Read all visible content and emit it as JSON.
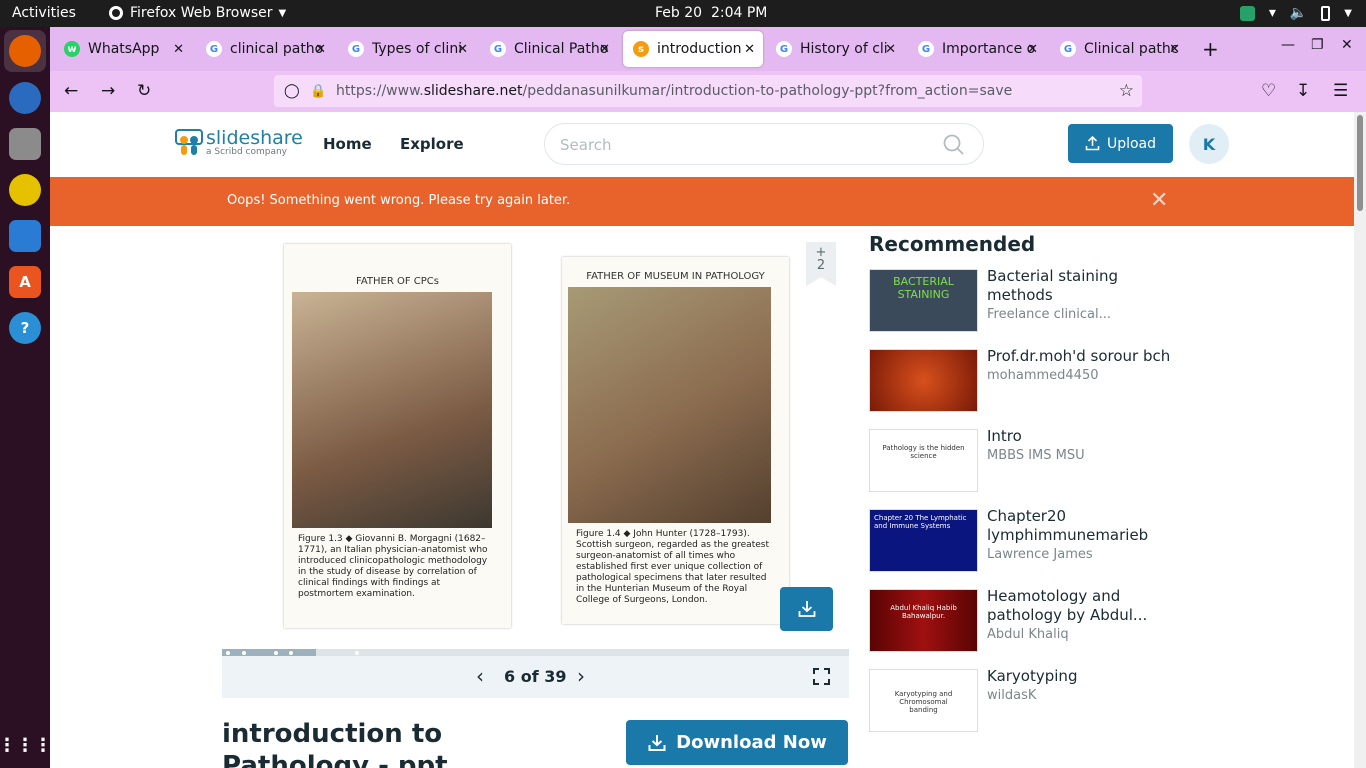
{
  "os": {
    "activities": "Activities",
    "app_name": "Firefox Web Browser",
    "date": "Feb 20",
    "time": "2:04 PM"
  },
  "tabs": [
    {
      "label": "WhatsApp",
      "icon": "whatsapp-icon",
      "color": "#25d366"
    },
    {
      "label": "clinical patho",
      "icon": "google-icon",
      "color": "#4285f4"
    },
    {
      "label": "Types of clini",
      "icon": "google-icon",
      "color": "#4285f4"
    },
    {
      "label": "Clinical Patho",
      "icon": "google-icon",
      "color": "#4285f4"
    },
    {
      "label": "introduction",
      "icon": "slideshare-icon",
      "color": "#f39c12"
    },
    {
      "label": "History of cli",
      "icon": "google-icon",
      "color": "#4285f4"
    },
    {
      "label": "Importance o",
      "icon": "google-icon",
      "color": "#4285f4"
    },
    {
      "label": "Clinical pathc",
      "icon": "google-icon",
      "color": "#4285f4"
    }
  ],
  "url": {
    "prefix": "https://www.",
    "domain": "slideshare.net",
    "path": "/peddanasunilkumar/introduction-to-pathology-ppt?from_action=save"
  },
  "site": {
    "logo": "slideshare",
    "logo_sub": "a Scribd company",
    "nav": [
      "Home",
      "Explore"
    ],
    "search_placeholder": "Search",
    "upload_label": "Upload",
    "avatar_letter": "K",
    "alert": "Oops! Something went wrong. Please try again later.",
    "badge_plus": "+",
    "badge_count": "2"
  },
  "slide": {
    "left_caption": "FATHER OF CPCs",
    "left_figure": "Figure 1.3 ◆ Giovanni B. Morgagni (1682–1771), an Italian physician-anatomist who introduced clinicopathologic methodology in the study of disease by correlation of clinical findings with findings at postmortem examination.",
    "right_caption": "FATHER OF MUSEUM IN PATHOLOGY",
    "right_figure": "Figure 1.4 ◆ John Hunter (1728–1793). Scottish surgeon, regarded as the greatest surgeon-anatomist of all times who established first ever unique collection of pathological specimens that later resulted in the Hunterian Museum of the Royal College of Surgeons, London.",
    "page_indicator": "6 of 39",
    "progress": 0.15
  },
  "document": {
    "title": "introduction to Pathology - ppt",
    "download_label": "Download Now"
  },
  "recommended": {
    "heading": "Recommended",
    "items": [
      {
        "title": "Bacterial staining methods",
        "author": "Freelance clinical...",
        "thumb_text": "BACTERIAL STAINING",
        "thumb_bg": "#3a4a5a"
      },
      {
        "title": "Prof.dr.moh'd sorour bch",
        "author": "mohammed4450",
        "thumb_text": "",
        "thumb_bg": "#a82a10"
      },
      {
        "title": "Intro",
        "author": "MBBS IMS MSU",
        "thumb_text": "Pathology is the hidden science",
        "thumb_bg": "#ffffff"
      },
      {
        "title": "Chapter20 lymphimmunemarieb",
        "author": "Lawrence James",
        "thumb_text": "Chapter 20 The Lymphatic and Immune Systems",
        "thumb_bg": "#0a1580"
      },
      {
        "title": "Heamotology and pathology by Abdul...",
        "author": "Abdul Khaliq",
        "thumb_text": "Abdul Khaliq Habib Bahawalpur.",
        "thumb_bg": "#7a0808"
      },
      {
        "title": "Karyotyping",
        "author": "wildasK",
        "thumb_text": "Karyotyping and Chromosomal banding",
        "thumb_bg": "#ffffff"
      }
    ]
  }
}
